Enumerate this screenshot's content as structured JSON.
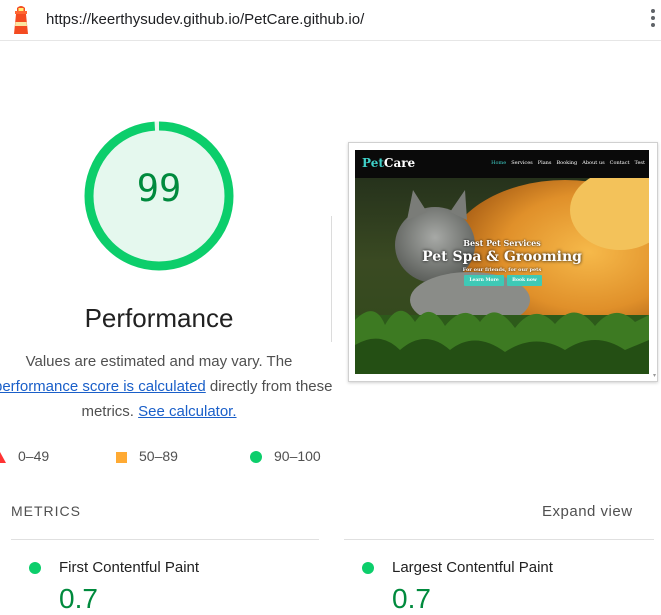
{
  "browser": {
    "url": "https://keerthysudev.github.io/PetCare.github.io/",
    "site_icon": "lighthouse-icon",
    "menu_icon": "kebab-menu-icon"
  },
  "gauge": {
    "score": "99",
    "score_fraction": 0.99,
    "category": "Performance",
    "colors": {
      "pass": "#0cce6b",
      "pass_text": "#008a3d",
      "pass_fill": "#e5f8ee"
    }
  },
  "description": {
    "line1": "Values are estimated and may vary. The",
    "link_score": "performance score is calculated",
    "line2_after": " directly from these",
    "line3_before": "metrics. ",
    "link_calc": "See calculator."
  },
  "legend": {
    "fail": {
      "label": "0–49",
      "color": "#ff3333"
    },
    "average": {
      "label": "50–89",
      "color": "#ffaa33"
    },
    "pass": {
      "label": "90–100",
      "color": "#0cce6b"
    }
  },
  "screenshot": {
    "brand_first": "Pet",
    "brand_second": "Care",
    "menu": [
      "Home",
      "Services",
      "Plans",
      "Booking",
      "About us",
      "Contact",
      "Test"
    ],
    "hero_subtitle": "Best Pet Services",
    "hero_title": "Pet Spa & Grooming",
    "hero_tagline": "For our friends, for our pets",
    "button_learn": "Learn More",
    "button_book": "Book now"
  },
  "metrics": {
    "title": "METRICS",
    "expand_label": "Expand view",
    "items": [
      {
        "label": "First Contentful Paint",
        "value": "0.7"
      },
      {
        "label": "Largest Contentful Paint",
        "value": "0.7"
      }
    ]
  }
}
